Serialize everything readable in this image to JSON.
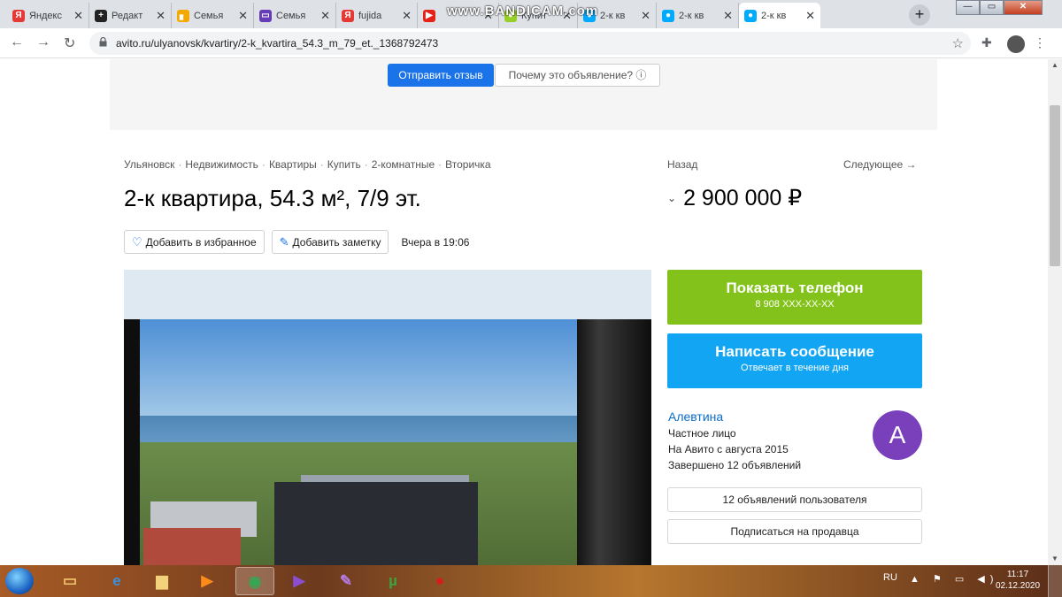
{
  "recording_watermark": "www.BANDICAM.com",
  "tabs": [
    {
      "label": "Яндекс",
      "icon": "yandex-icon",
      "color": "#e53935",
      "glyph": "Я"
    },
    {
      "label": "Редакт",
      "icon": "editor-icon",
      "color": "#222222",
      "glyph": "+"
    },
    {
      "label": "Семья",
      "icon": "chart-icon",
      "color": "#f2a900",
      "glyph": "▖"
    },
    {
      "label": "Семья",
      "icon": "video-icon",
      "color": "#673ab7",
      "glyph": "▭"
    },
    {
      "label": "fujida",
      "icon": "yandex-icon",
      "color": "#e53935",
      "glyph": "Я"
    },
    {
      "label": "",
      "icon": "youtube-icon",
      "color": "#e62117",
      "glyph": "▶"
    },
    {
      "label": "Купит",
      "icon": "avito-icon",
      "color": "#97cf26",
      "glyph": "●"
    },
    {
      "label": "2-к кв",
      "icon": "avito-icon",
      "color": "#00aaff",
      "glyph": "●"
    },
    {
      "label": "2-к кв",
      "icon": "avito-icon",
      "color": "#00aaff",
      "glyph": "●"
    },
    {
      "label": "2-к кв",
      "icon": "avito-icon",
      "color": "#00aaff",
      "glyph": "●"
    }
  ],
  "address": {
    "url": "avito.ru/ulyanovsk/kvartiry/2-k_kvartira_54.3_m_79_et._1368792473"
  },
  "feedback": {
    "send_label": "Отправить отзыв",
    "why_label": "Почему это объявление? ⓘ"
  },
  "breadcrumbs": [
    "Ульяновск",
    "Недвижимость",
    "Квартиры",
    "Купить",
    "2-комнатные",
    "Вторичка"
  ],
  "listing": {
    "title": "2-к квартира, 54.3 м², 7/9 эт.",
    "favorite_label": "Добавить в избранное",
    "note_label": "Добавить заметку",
    "posted": "Вчера в 19:06",
    "back_label": "Назад",
    "next_label": "Следующее →",
    "price": "2 900 000 ₽"
  },
  "contact": {
    "phone_title": "Показать телефон",
    "phone_number": "8 908 XXX-XX-XX",
    "message_title": "Написать сообщение",
    "message_sub": "Отвечает в течение дня"
  },
  "seller": {
    "name": "Алевтина",
    "type": "Частное лицо",
    "since": "На Авито с августа 2015",
    "completed": "Завершено 12 объявлений",
    "avatar_letter": "A",
    "listings_label": "12 объявлений пользователя",
    "subscribe_label": "Подписаться на продавца"
  },
  "taskbar": {
    "apps": [
      {
        "name": "explorer-icon",
        "glyph": "▭",
        "color": "#f3c76a"
      },
      {
        "name": "ie-icon",
        "glyph": "e",
        "color": "#3a8fe0"
      },
      {
        "name": "folder-icon",
        "glyph": "▆",
        "color": "#f2d27a"
      },
      {
        "name": "media-player-icon",
        "glyph": "▶",
        "color": "#ff8c1a"
      },
      {
        "name": "chrome-icon",
        "glyph": "◉",
        "color": "#34a853"
      },
      {
        "name": "visual-studio-icon",
        "glyph": "▶",
        "color": "#8a4fd1"
      },
      {
        "name": "feather-icon",
        "glyph": "✎",
        "color": "#b57ae0"
      },
      {
        "name": "utorrent-icon",
        "glyph": "µ",
        "color": "#3fa33f"
      },
      {
        "name": "bandicam-icon",
        "glyph": "●",
        "color": "#d81b1b"
      }
    ],
    "language": "RU",
    "time": "11:17",
    "date": "02.12.2020"
  }
}
